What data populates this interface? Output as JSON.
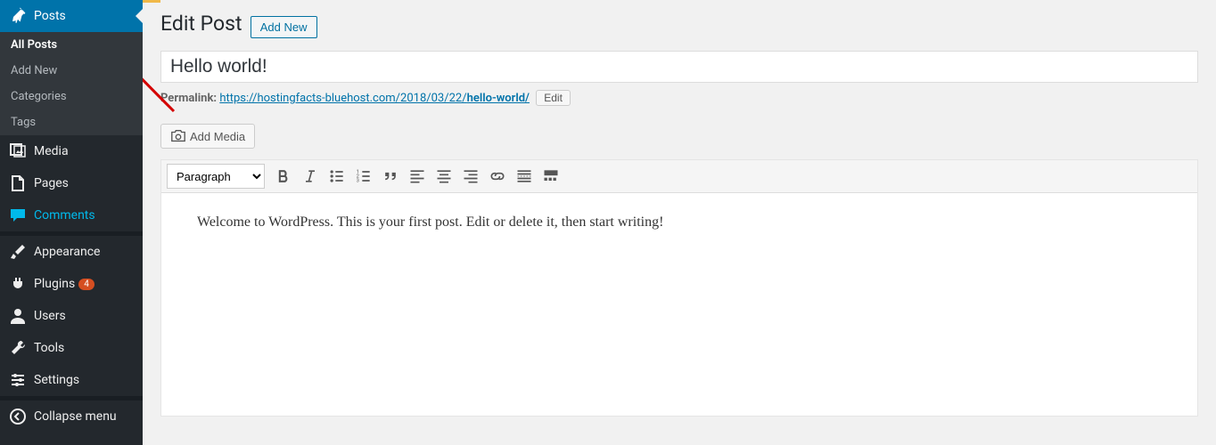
{
  "sidebar": {
    "posts": "Posts",
    "submenu": {
      "all_posts": "All Posts",
      "add_new": "Add New",
      "categories": "Categories",
      "tags": "Tags"
    },
    "media": "Media",
    "pages": "Pages",
    "comments": "Comments",
    "appearance": "Appearance",
    "plugins": "Plugins",
    "plugins_badge": "4",
    "users": "Users",
    "tools": "Tools",
    "settings": "Settings",
    "collapse": "Collapse menu"
  },
  "header": {
    "title": "Edit Post",
    "add_new": "Add New"
  },
  "post": {
    "title": "Hello world!",
    "permalink_label": "Permalink:",
    "permalink_base": "https://hostingfacts-bluehost.com/2018/03/22/",
    "permalink_slug": "hello-world/",
    "edit_btn": "Edit",
    "add_media": "Add Media",
    "format_select": "Paragraph",
    "body": "Welcome to WordPress. This is your first post. Edit or delete it, then start writing!"
  }
}
